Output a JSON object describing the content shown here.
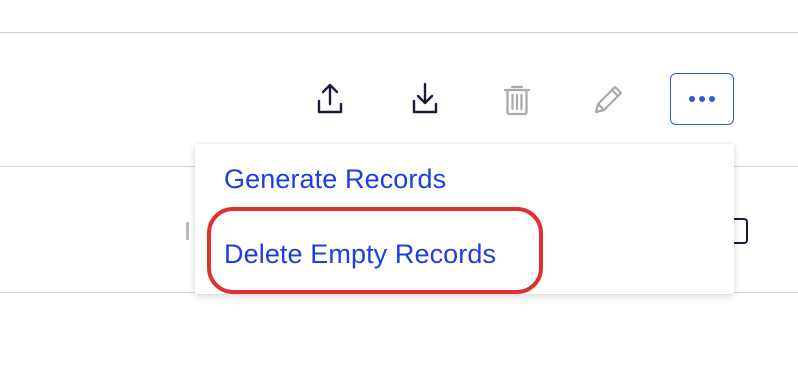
{
  "toolbar": {
    "buttons": [
      {
        "name": "export",
        "icon": "upload-tray-icon"
      },
      {
        "name": "import",
        "icon": "download-tray-icon"
      },
      {
        "name": "delete",
        "icon": "trash-icon",
        "disabled": true
      },
      {
        "name": "edit",
        "icon": "pencil-icon",
        "disabled": true
      },
      {
        "name": "more",
        "icon": "more-horizontal-icon"
      }
    ]
  },
  "dropdown": {
    "items": [
      {
        "label": "Generate Records"
      },
      {
        "label": "Delete Empty Records"
      }
    ]
  },
  "colors": {
    "accent": "#2b59e6",
    "menu_text": "#1b3fe0",
    "icon_active": "#1b1b3a",
    "icon_disabled": "#a8a8ad",
    "highlight": "#e03131"
  }
}
